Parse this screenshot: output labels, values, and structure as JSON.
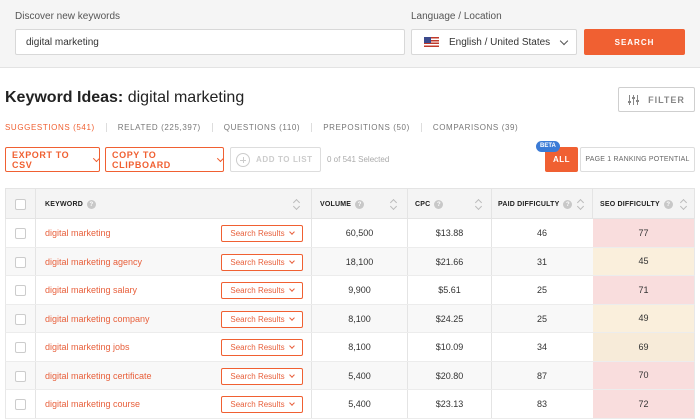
{
  "search": {
    "keyword_label": "Discover new keywords",
    "keyword_value": "digital marketing",
    "language_label": "Language / Location",
    "language_value": "English / United States",
    "search_button": "SEARCH"
  },
  "title": {
    "prefix": "Keyword Ideas:",
    "term": "digital marketing"
  },
  "filter_button": "FILTER",
  "tabs": [
    {
      "label": "SUGGESTIONS (541)",
      "active": true
    },
    {
      "label": "RELATED (225,397)",
      "active": false
    },
    {
      "label": "QUESTIONS (110)",
      "active": false
    },
    {
      "label": "PREPOSITIONS (50)",
      "active": false
    },
    {
      "label": "COMPARISONS (39)",
      "active": false
    }
  ],
  "actions": {
    "export_csv": "EXPORT TO CSV",
    "copy_clipboard": "COPY TO CLIPBOARD",
    "add_to_list": "ADD TO LIST",
    "selected_count": "0 of 541 Selected",
    "beta_badge": "BETA",
    "all_filter": "ALL",
    "page1_filter": "PAGE 1 RANKING POTENTIAL"
  },
  "table": {
    "headers": {
      "keyword": "KEYWORD",
      "volume": "VOLUME",
      "cpc": "CPC",
      "paid": "PAID DIFFICULTY",
      "seo": "SEO DIFFICULTY"
    },
    "search_results_label": "Search Results",
    "rows": [
      {
        "keyword": "digital marketing",
        "volume": "60,500",
        "cpc": "$13.88",
        "paid": "46",
        "seo": "77",
        "seo_color": "#f9dddd"
      },
      {
        "keyword": "digital marketing agency",
        "volume": "18,100",
        "cpc": "$21.66",
        "paid": "31",
        "seo": "45",
        "seo_color": "#faefdc"
      },
      {
        "keyword": "digital marketing salary",
        "volume": "9,900",
        "cpc": "$5.61",
        "paid": "25",
        "seo": "71",
        "seo_color": "#f9dddd"
      },
      {
        "keyword": "digital marketing company",
        "volume": "8,100",
        "cpc": "$24.25",
        "paid": "25",
        "seo": "49",
        "seo_color": "#faefdc"
      },
      {
        "keyword": "digital marketing jobs",
        "volume": "8,100",
        "cpc": "$10.09",
        "paid": "34",
        "seo": "69",
        "seo_color": "#f7ebd9"
      },
      {
        "keyword": "digital marketing certificate",
        "volume": "5,400",
        "cpc": "$20.80",
        "paid": "87",
        "seo": "70",
        "seo_color": "#f9dddd"
      },
      {
        "keyword": "digital marketing course",
        "volume": "5,400",
        "cpc": "$23.13",
        "paid": "83",
        "seo": "72",
        "seo_color": "#f9dddd"
      }
    ]
  },
  "colors": {
    "accent": "#f06032",
    "beta": "#3b7bd6"
  },
  "icons": [
    "us-flag-icon",
    "chevron-down-icon",
    "filter-sliders-icon",
    "plus-circle-icon",
    "help-icon",
    "sort-icon"
  ]
}
